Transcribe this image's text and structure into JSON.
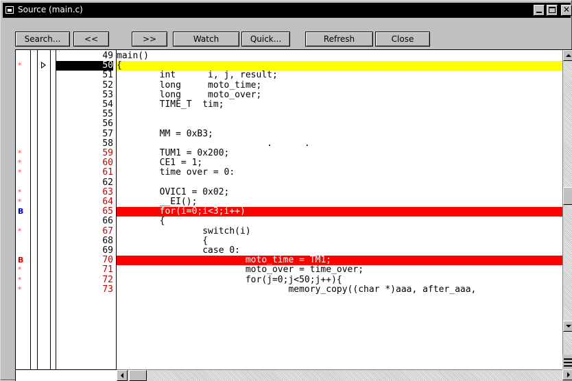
{
  "window": {
    "title": "Source (main.c)"
  },
  "toolbar": {
    "search": "Search...",
    "back": "<<",
    "forward": ">>",
    "watch": "Watch",
    "quick": "Quick...",
    "refresh": "Refresh",
    "close": "Close"
  },
  "source": {
    "lines": [
      {
        "num": "49",
        "text": "main()",
        "mark": "",
        "current": false,
        "highlight": ""
      },
      {
        "num": "50",
        "text": "{",
        "mark": "*",
        "current": true,
        "highlight": "yellow"
      },
      {
        "num": "51",
        "text": "        int      i, j, result;",
        "mark": "",
        "current": false,
        "highlight": ""
      },
      {
        "num": "52",
        "text": "        long     moto_time;",
        "mark": "",
        "current": false,
        "highlight": ""
      },
      {
        "num": "53",
        "text": "        long     moto_over;",
        "mark": "",
        "current": false,
        "highlight": ""
      },
      {
        "num": "54",
        "text": "        TIME_T  tim;",
        "mark": "",
        "current": false,
        "highlight": ""
      },
      {
        "num": "55",
        "text": "",
        "mark": "",
        "current": false,
        "highlight": ""
      },
      {
        "num": "56",
        "text": "",
        "mark": "",
        "current": false,
        "highlight": ""
      },
      {
        "num": "57",
        "text": "        MM = 0xB3;",
        "mark": "",
        "current": false,
        "highlight": ""
      },
      {
        "num": "58",
        "text": "                            .      .",
        "mark": "",
        "current": false,
        "highlight": ""
      },
      {
        "num": "59",
        "text": "        TUM1 = 0x200;",
        "mark": "*",
        "current": false,
        "highlight": ""
      },
      {
        "num": "60",
        "text": "        CE1 = 1;",
        "mark": "*",
        "current": false,
        "highlight": ""
      },
      {
        "num": "61",
        "text": "        time over = 0:",
        "mark": "*",
        "current": false,
        "highlight": ""
      },
      {
        "num": "62",
        "text": "",
        "mark": "",
        "current": false,
        "highlight": ""
      },
      {
        "num": "63",
        "text": "        OVIC1 = 0x02;",
        "mark": "*",
        "current": false,
        "highlight": ""
      },
      {
        "num": "64",
        "text": "        __EI();",
        "mark": "*",
        "current": false,
        "highlight": ""
      },
      {
        "num": "65",
        "text": "        for(i=0;i<3;i++)",
        "mark": "B",
        "markColor": "blue",
        "current": false,
        "highlight": "red"
      },
      {
        "num": "66",
        "text": "        {",
        "mark": "",
        "current": false,
        "highlight": ""
      },
      {
        "num": "67",
        "text": "                switch(i)",
        "mark": "*",
        "current": false,
        "highlight": ""
      },
      {
        "num": "68",
        "text": "                {",
        "mark": "",
        "current": false,
        "highlight": ""
      },
      {
        "num": "69",
        "text": "                case 0:",
        "mark": "",
        "current": false,
        "highlight": ""
      },
      {
        "num": "70",
        "text": "                        moto_time = TM1;",
        "mark": "B",
        "markColor": "red",
        "current": false,
        "highlight": "red"
      },
      {
        "num": "71",
        "text": "                        moto_over = time_over;",
        "mark": "*",
        "current": false,
        "highlight": ""
      },
      {
        "num": "72",
        "text": "                        for(j=0;j<50;j++){",
        "mark": "*",
        "current": false,
        "highlight": ""
      },
      {
        "num": "73",
        "text": "                                memory_copy((char *)aaa, after_aaa, ",
        "mark": "*",
        "current": false,
        "highlight": ""
      }
    ]
  },
  "colors": {
    "current_line": "#ffff00",
    "breakpoint_line": "#ff0000",
    "title_bar": "#000000",
    "window_face": "#c0c0c0"
  }
}
